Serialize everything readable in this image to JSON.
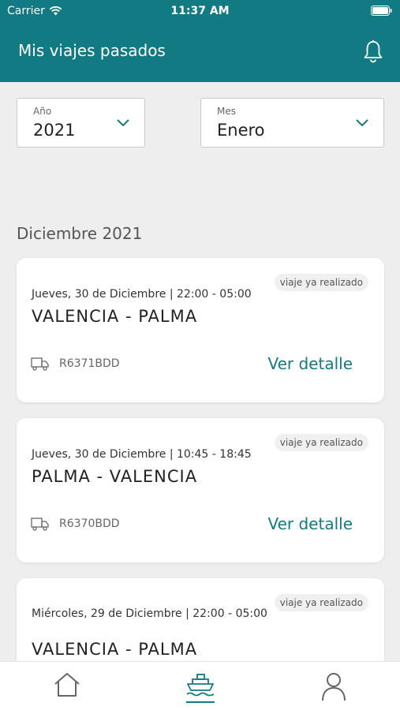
{
  "status_bar": {
    "carrier": "Carrier",
    "time": "11:37 AM"
  },
  "header": {
    "title": "Mis viajes pasados",
    "icon": "bell-icon"
  },
  "filters": {
    "year": {
      "label": "Año",
      "value": "2021"
    },
    "month": {
      "label": "Mes",
      "value": "Enero"
    }
  },
  "section": {
    "heading": "Diciembre 2021"
  },
  "trips": [
    {
      "badge": "viaje ya realizado",
      "date": "Jueves, 30 de Diciembre | 22:00 - 05:00",
      "route": "VALENCIA - PALMA",
      "plate": "R6371BDD",
      "detail_label": "Ver detalle"
    },
    {
      "badge": "viaje ya realizado",
      "date": "Jueves, 30 de Diciembre | 10:45 - 18:45",
      "route": "PALMA - VALENCIA",
      "plate": "R6370BDD",
      "detail_label": "Ver detalle"
    },
    {
      "badge": "viaje ya realizado",
      "date": "Miércoles, 29 de Diciembre | 22:00 - 05:00",
      "route": "VALENCIA - PALMA"
    }
  ],
  "tabbar": {
    "items": [
      {
        "icon": "home-icon"
      },
      {
        "icon": "ship-icon",
        "active": true
      },
      {
        "icon": "user-icon"
      }
    ]
  },
  "colors": {
    "brand": "#127a82",
    "background": "#eeeeee"
  }
}
